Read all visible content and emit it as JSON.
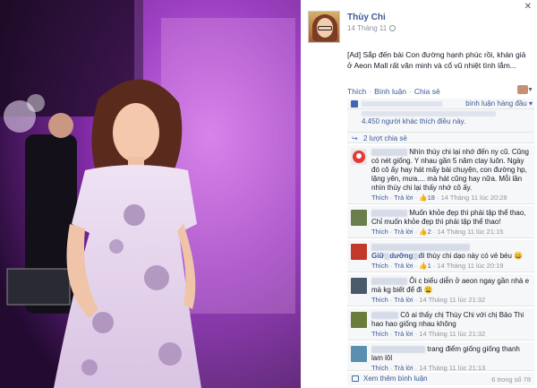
{
  "post": {
    "author": "Thùy Chi",
    "date": "14 Tháng 11",
    "text": "[Ad] Sắp đến bài Con đường hạnh phúc rồi, khán giả ở Aeon Mall rất văn minh và cổ vũ nhiệt tình lắm...",
    "actions": {
      "like": "Thích",
      "comment": "Bình luận",
      "share": "Chia sẻ",
      "sep": "·"
    }
  },
  "ufi": {
    "sort_label": "bình luận hàng đầu ▾",
    "likes_text": "4.450 người khác thích điều này.",
    "shares_text": "2 lượt chia sẻ"
  },
  "comments": [
    {
      "name": "",
      "text": "Nhìn thùy chi lại nhớ đến ny cũ. Cũng có nét giống. Y nhau gần 5 năm ctay luôn. Ngày đó cô ấy hay hát mấy bài chuyện, con đường hp, lặng yên, mưa.... mà hát cũng hay nữa. Mỗi lần nhìn thùy chi lại thấy nhớ cô ấy.",
      "like": "Thích",
      "reply": "Trả lời",
      "likes": "18",
      "time": "14 Tháng 11 lúc 20:28"
    },
    {
      "name": "",
      "text": "Muốn khỏe đẹp thì phải tập thể thao, Chỉ muốn khỏe đẹp thì phải tập thể thao!",
      "like": "Thích",
      "reply": "Trả lời",
      "likes": "2",
      "time": "14 Tháng 11 lúc 21:15"
    },
    {
      "name": "Giữ",
      "name2": "dưỡng",
      "name3": "đi",
      "text": "thùy chi dạo này có vẻ béu 😄",
      "like": "Thích",
      "reply": "Trả lời",
      "likes": "1",
      "time": "14 Tháng 11 lúc 20:19"
    },
    {
      "name": "",
      "text": "Ôi c biểu diễn ở aeon ngay gần nhà e mà kg biết để đi 😩",
      "like": "Thích",
      "reply": "Trả lời",
      "time": "14 Tháng 11 lúc 21:32"
    },
    {
      "name": "",
      "text": "Cô ai thấy chị Thùy Chi với chị Bảo Thi hao hao giống nhau không",
      "like": "Thích",
      "reply": "Trả lời",
      "time": "14 Tháng 11 lúc 21:32"
    },
    {
      "name": "",
      "text": "trang điểm giống giống thanh lam lôl",
      "like": "Thích",
      "reply": "Trả lời",
      "time": "14 Tháng 11 lúc 21:13"
    }
  ],
  "more": {
    "label": "Xem thêm bình luận",
    "count": "6 trong số 78"
  },
  "colors": {
    "link": "#3b5998",
    "panel_bg": "#f6f7f9",
    "meta": "#90949c"
  },
  "icons": [
    "close-icon",
    "globe-icon",
    "like-icon",
    "share-icon",
    "comment-icon"
  ]
}
